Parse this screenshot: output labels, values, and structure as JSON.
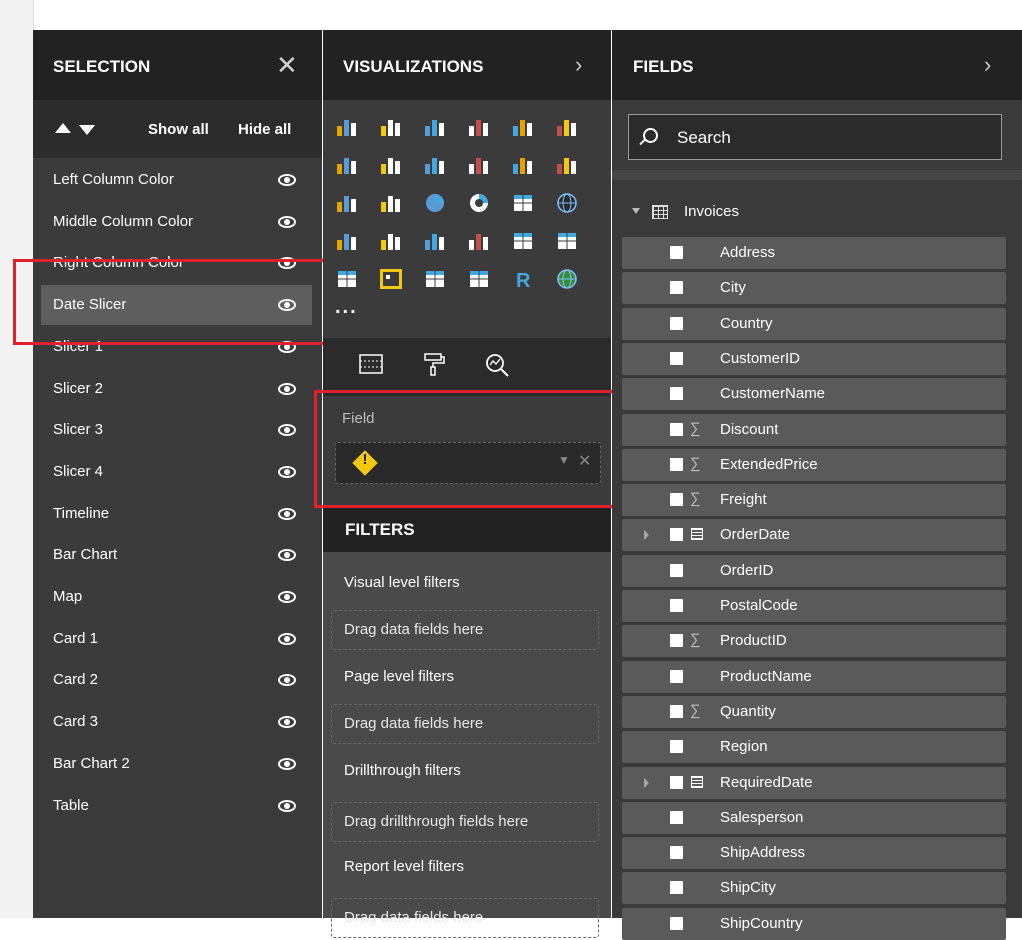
{
  "selection": {
    "title": "SELECTION",
    "show_all": "Show all",
    "hide_all": "Hide all",
    "items": [
      {
        "label": "Left Column Color"
      },
      {
        "label": "Middle Column Color"
      },
      {
        "label": "Right Column Color"
      },
      {
        "label": "Date Slicer",
        "selected": true
      },
      {
        "label": "Slicer 1"
      },
      {
        "label": "Slicer 2"
      },
      {
        "label": "Slicer 3"
      },
      {
        "label": "Slicer 4"
      },
      {
        "label": "Timeline"
      },
      {
        "label": "Bar Chart"
      },
      {
        "label": "Map"
      },
      {
        "label": "Card 1"
      },
      {
        "label": "Card 2"
      },
      {
        "label": "Card 3"
      },
      {
        "label": "Bar Chart 2"
      },
      {
        "label": "Table"
      }
    ]
  },
  "visualizations": {
    "title": "VISUALIZATIONS",
    "more": "...",
    "field_label": "Field",
    "icon_names": [
      "stacked-bar",
      "stacked-column",
      "clustered-bar",
      "clustered-column",
      "100-bar",
      "100-column",
      "line",
      "area",
      "stacked-area",
      "line-column",
      "line-clustered",
      "ribbon",
      "waterfall",
      "scatter",
      "pie",
      "donut",
      "treemap",
      "map",
      "filled-map",
      "shape-map",
      "funnel",
      "gauge",
      "card",
      "multi-row-card",
      "kpi",
      "slicer",
      "table",
      "matrix",
      "r-visual",
      "globe"
    ],
    "filters": {
      "title": "FILTERS",
      "visual_level": "Visual level filters",
      "page_level": "Page level filters",
      "drillthrough": "Drillthrough filters",
      "report_level": "Report level filters",
      "drag_data": "Drag data fields here",
      "drag_drill": "Drag drillthrough fields here"
    }
  },
  "fields": {
    "title": "FIELDS",
    "search_placeholder": "Search",
    "table_name": "Invoices",
    "items": [
      {
        "name": "Address",
        "type": "text"
      },
      {
        "name": "City",
        "type": "text"
      },
      {
        "name": "Country",
        "type": "text"
      },
      {
        "name": "CustomerID",
        "type": "text"
      },
      {
        "name": "CustomerName",
        "type": "text"
      },
      {
        "name": "Discount",
        "type": "sum"
      },
      {
        "name": "ExtendedPrice",
        "type": "sum"
      },
      {
        "name": "Freight",
        "type": "sum"
      },
      {
        "name": "OrderDate",
        "type": "date"
      },
      {
        "name": "OrderID",
        "type": "text"
      },
      {
        "name": "PostalCode",
        "type": "text"
      },
      {
        "name": "ProductID",
        "type": "sum"
      },
      {
        "name": "ProductName",
        "type": "text"
      },
      {
        "name": "Quantity",
        "type": "sum"
      },
      {
        "name": "Region",
        "type": "text"
      },
      {
        "name": "RequiredDate",
        "type": "date"
      },
      {
        "name": "Salesperson",
        "type": "text"
      },
      {
        "name": "ShipAddress",
        "type": "text"
      },
      {
        "name": "ShipCity",
        "type": "text"
      },
      {
        "name": "ShipCountry",
        "type": "text"
      }
    ]
  },
  "colors": {
    "highlight": "#e0202a",
    "panel": "#3b3b3b",
    "header": "#222222",
    "warning": "#f2c811"
  }
}
